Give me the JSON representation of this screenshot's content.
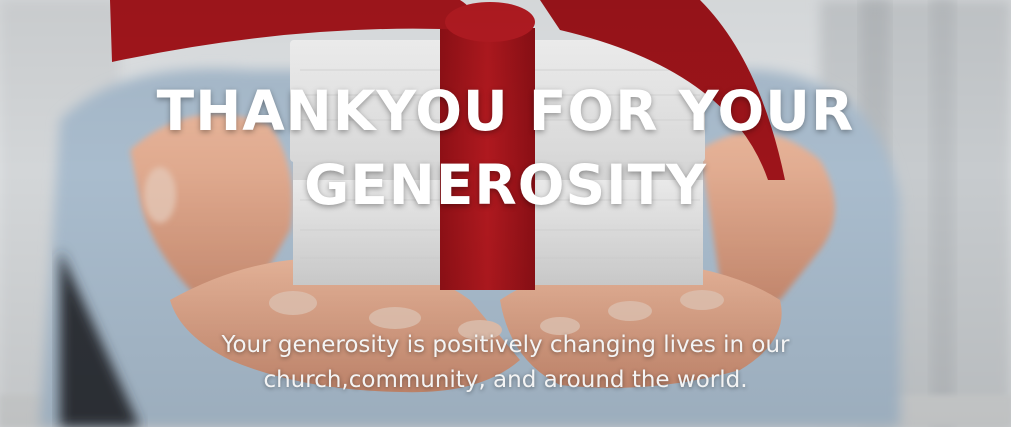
{
  "hero": {
    "headline_line1": "THANKYOU FOR YOUR",
    "headline_line2": "GENEROSITY",
    "subtext_line1": "Your generosity is positively changing lives in our",
    "subtext_line2": "church,community, and around the world.",
    "colors": {
      "ribbon": "#a3161c",
      "box": "#e9e9e9",
      "skin": "#e1a88c",
      "shirt": "#9fb3c6",
      "text": "#ffffff"
    },
    "image_subject": "hands-holding-gift-box"
  }
}
